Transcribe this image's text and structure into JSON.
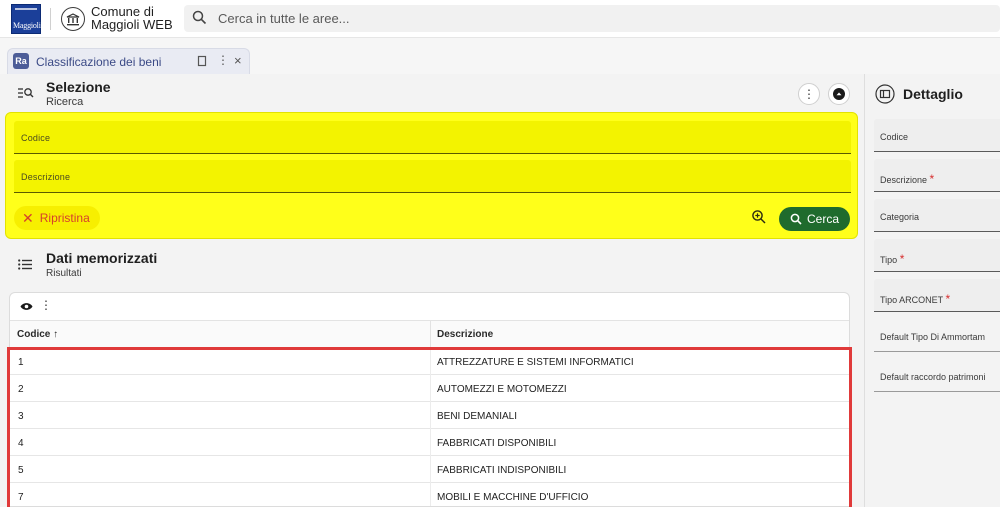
{
  "header": {
    "logo_text": "Maggioli",
    "app_name_line1": "Comune di",
    "app_name_line2": "Maggioli WEB",
    "search_placeholder": "Cerca in tutte le aree..."
  },
  "tab": {
    "badge": "Ra",
    "title": "Classificazione dei beni",
    "more": "⋮",
    "close": "×"
  },
  "selezione": {
    "title": "Selezione",
    "subtitle": "Ricerca",
    "fields": [
      {
        "label": "Codice",
        "value": ""
      },
      {
        "label": "Descrizione",
        "value": ""
      }
    ],
    "reset_label": "Ripristina",
    "search_label": "Cerca",
    "highlight_color": "#ffff1a"
  },
  "dati": {
    "title": "Dati memorizzati",
    "subtitle": "Risultati",
    "columns": [
      "Codice ↑",
      "Descrizione"
    ],
    "rows": [
      {
        "codice": "1",
        "descrizione": "ATTREZZATURE E SISTEMI INFORMATICI"
      },
      {
        "codice": "2",
        "descrizione": "AUTOMEZZI E MOTOMEZZI"
      },
      {
        "codice": "3",
        "descrizione": "BENI DEMANIALI"
      },
      {
        "codice": "4",
        "descrizione": "FABBRICATI DISPONIBILI"
      },
      {
        "codice": "5",
        "descrizione": "FABBRICATI INDISPONIBILI"
      },
      {
        "codice": "7",
        "descrizione": "MOBILI E MACCHINE D'UFFICIO"
      }
    ],
    "frame_color": "#e03a3a"
  },
  "dettaglio": {
    "title": "Dettaglio",
    "fields": [
      {
        "label": "Codice",
        "required": false
      },
      {
        "label": "Descrizione",
        "required": true
      },
      {
        "label": "Categoria",
        "required": false
      },
      {
        "label": "Tipo",
        "required": true
      },
      {
        "label": "Tipo ARCONET",
        "required": true
      },
      {
        "label": "Default Tipo Di Ammortam",
        "required": false
      },
      {
        "label": "Default raccordo patrimoni",
        "required": false
      }
    ]
  }
}
